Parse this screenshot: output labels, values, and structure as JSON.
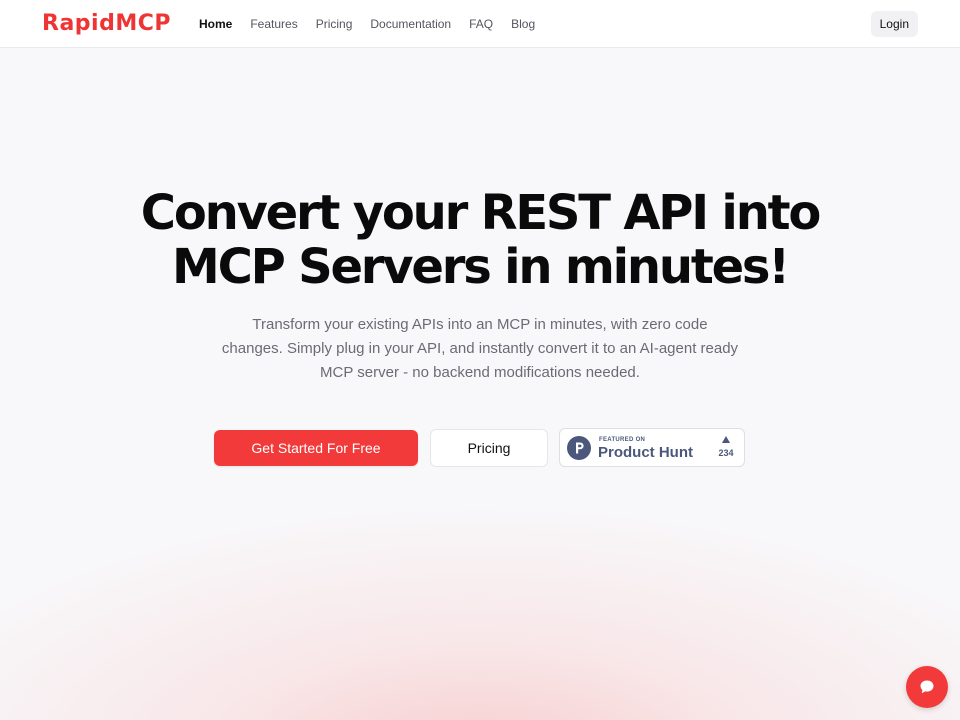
{
  "header": {
    "logo_text": "RapidMCP",
    "nav": [
      {
        "label": "Home",
        "active": true
      },
      {
        "label": "Features",
        "active": false
      },
      {
        "label": "Pricing",
        "active": false
      },
      {
        "label": "Documentation",
        "active": false
      },
      {
        "label": "FAQ",
        "active": false
      },
      {
        "label": "Blog",
        "active": false
      }
    ],
    "login_label": "Login"
  },
  "hero": {
    "title_line1": "Convert your REST API into",
    "title_line2": "MCP Servers in minutes!",
    "subtitle": "Transform your existing APIs into an MCP in minutes, with zero code changes. Simply plug in your API, and instantly convert it to an AI-agent ready MCP server - no backend modifications needed."
  },
  "cta": {
    "primary_label": "Get Started For Free",
    "secondary_label": "Pricing"
  },
  "product_hunt": {
    "featured_label": "FEATURED ON",
    "name": "Product Hunt",
    "upvotes": "234",
    "icon": "product-hunt-icon"
  },
  "chat": {
    "icon": "chat-bubble-icon"
  },
  "colors": {
    "accent": "#f23a3a",
    "logo": "#ef3434",
    "product_hunt": "#4b587c",
    "text_muted": "#6b6b74"
  }
}
